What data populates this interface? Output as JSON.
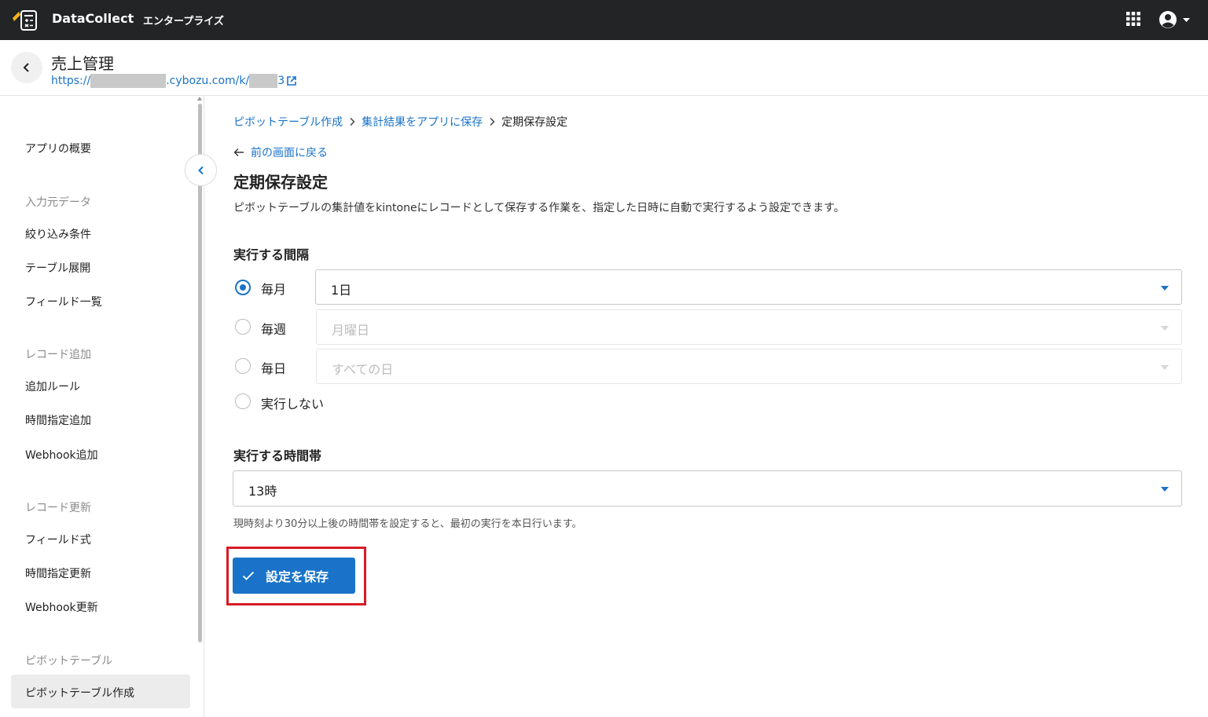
{
  "topbar": {
    "brand": "DataCollect",
    "edition": "エンタープライズ"
  },
  "app": {
    "title": "売上管理",
    "url_prefix": "https://",
    "url_middle": ".cybozu.com/k/",
    "url_suffix": "3"
  },
  "sidebar": {
    "overview": "アプリの概要",
    "input_section": "入力元データ",
    "filter": "絞り込み条件",
    "table_expand": "テーブル展開",
    "field_list": "フィールド一覧",
    "record_add_section": "レコード追加",
    "add_rules": "追加ルール",
    "scheduled_add": "時間指定追加",
    "webhook_add": "Webhook追加",
    "record_update_section": "レコード更新",
    "field_formula": "フィールド式",
    "scheduled_update": "時間指定更新",
    "webhook_update": "Webhook更新",
    "pivot_section": "ピボットテーブル",
    "pivot_create": "ピボットテーブル作成"
  },
  "breadcrumb": {
    "item1": "ピボットテーブル作成",
    "item2": "集計結果をアプリに保存",
    "item3": "定期保存設定"
  },
  "main": {
    "back_link": "前の画面に戻る",
    "title": "定期保存設定",
    "description": "ピボットテーブルの集計値をkintoneにレコードとして保存する作業を、指定した日時に自動で実行するよう設定できます。",
    "interval_label": "実行する間隔",
    "interval_options": {
      "monthly": "毎月",
      "weekly": "毎週",
      "daily": "毎日",
      "none": "実行しない"
    },
    "monthly_value": "1日",
    "weekly_value": "月曜日",
    "daily_value": "すべての日",
    "time_label": "実行する時間帯",
    "time_value": "13時",
    "hint": "現時刻より30分以上後の時間帯を設定すると、最初の実行を本日行います。",
    "save_button": "設定を保存"
  },
  "colors": {
    "accent": "#1a73c8",
    "topbar": "#222425",
    "highlight": "#d81b25"
  }
}
